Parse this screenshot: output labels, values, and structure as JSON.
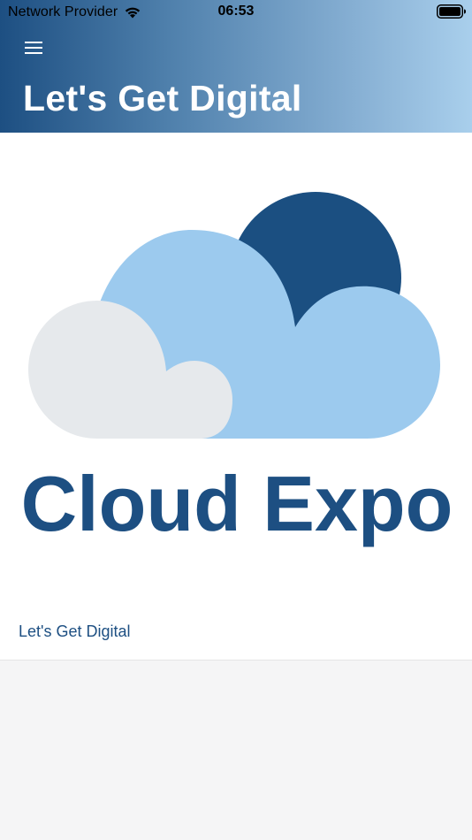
{
  "status_bar": {
    "carrier": "Network Provider",
    "time": "06:53",
    "wifi_icon": "wifi-icon",
    "battery_icon": "battery-icon"
  },
  "header": {
    "menu_icon": "hamburger-menu-icon",
    "title": "Let's Get Digital"
  },
  "card": {
    "logo_text": "Cloud Expo",
    "caption": "Let's Get Digital"
  },
  "colors": {
    "brand_dark_blue": "#1d4f82",
    "cloud_light_blue": "#9ccaee",
    "cloud_grey": "#e6e9ec",
    "page_background": "#f5f5f6"
  }
}
